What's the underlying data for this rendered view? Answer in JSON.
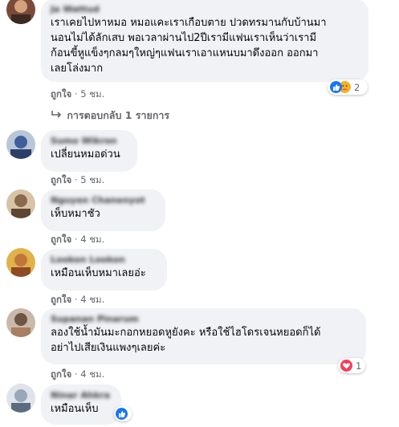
{
  "comments": [
    {
      "name": "Ja Wattud",
      "lines": "เราเคยไปหาหมอ หมอแคะเราเกือบตาย ปวดทรมานกับบ้านมา\nนอนไม่ได้ลักเสบ พอเวลาผ่านไป2ปีเรามีแฟนเราเห็นว่าเรามี\nก้อนขี้หูแข็งๆกลมๆใหญ่ๆแฟนเราเอาแหนบมาดึงออก ออกมา\nเลยโล่งมาก",
      "like": "ถูกใจ",
      "time": "5 ชม.",
      "reaction_count": "2",
      "reply": "การตอบกลับ 1 รายการ"
    },
    {
      "name": "Sumo Wikron",
      "lines": "เปลี่ยนหมอด่วน",
      "like": "ถูกใจ",
      "time": "5 ชม."
    },
    {
      "name": "Nguyen Chanenyot",
      "lines": "เห็บหมาชัว",
      "like": "ถูกใจ",
      "time": "4 ชม."
    },
    {
      "name": "Lookon Lookon",
      "lines": "เหมือนเห็บหมาเลยอ่ะ",
      "like": "ถูกใจ",
      "time": "4 ชม."
    },
    {
      "name": "Supanan Pinarum",
      "lines": "ลองใช้น้ำมันมะกอกหยอดหูยังคะ หรือใช้ไฮโดรเจนหยอดก็ได้\nอย่าไปเสียเงินแพงๆเลยค่ะ",
      "like": "ถูกใจ",
      "time": "4 ชม.",
      "reaction_count": "1"
    },
    {
      "name": "Ninar Ahkra",
      "lines": "เหมือนเห็บ"
    }
  ],
  "separator": "·",
  "colors": {
    "like_blue": "#1877f2",
    "love_red": "#f33e58",
    "haha_yellow": "#f7b125"
  }
}
